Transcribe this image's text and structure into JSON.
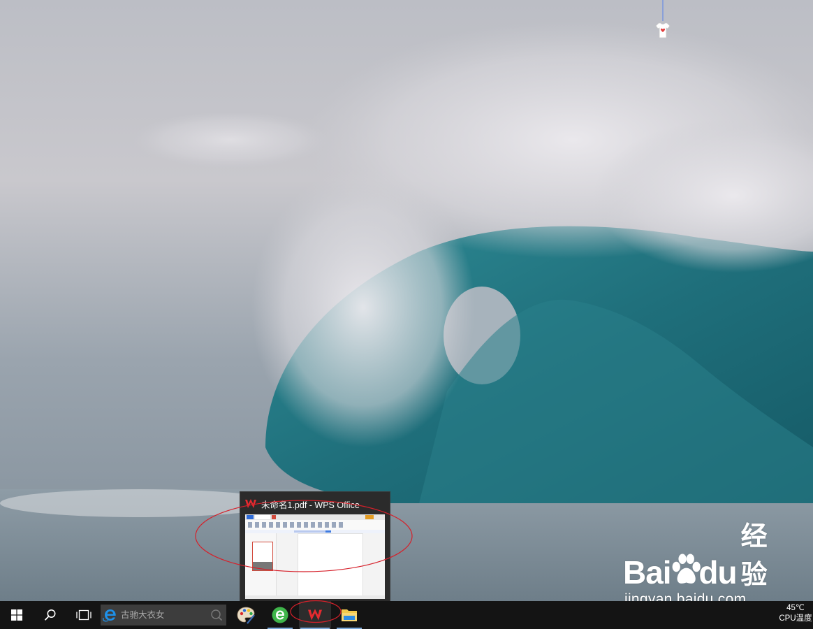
{
  "preview": {
    "title": "未命名1.pdf - WPS Office",
    "app_icon": "wps-icon"
  },
  "taskbar": {
    "start_icon": "windows-start-icon",
    "search_icon": "search-icon",
    "taskview_icon": "task-view-icon",
    "search_placeholder": "古驰大衣女",
    "apps": [
      {
        "name": "paint",
        "icon": "paint-palette-icon",
        "running": false
      },
      {
        "name": "browser",
        "icon": "browser-e-icon",
        "running": true
      },
      {
        "name": "wps",
        "icon": "wps-icon",
        "running": true,
        "active": true
      },
      {
        "name": "explorer",
        "icon": "folder-icon",
        "running": true
      }
    ],
    "tray": {
      "temperature": "45℃",
      "temperature_label": "CPU温度"
    }
  },
  "watermark": {
    "logo_text_left": "Bai",
    "logo_text_right": "du",
    "logo_text_cn": "经验",
    "url": "jingyan.baidu.com"
  },
  "colors": {
    "taskbar": "#141414",
    "annotation": "#d6202a",
    "wps_red": "#d8262f"
  }
}
